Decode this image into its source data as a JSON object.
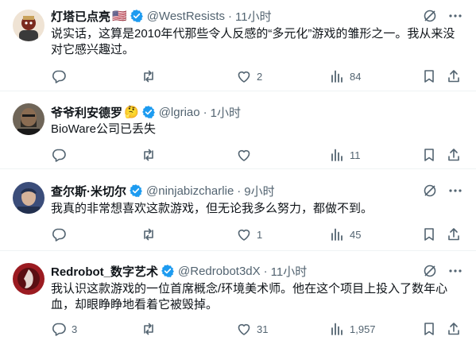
{
  "tweets": [
    {
      "name": "灯塔已点亮",
      "flag": "🇺🇸",
      "handle": "@WestResists",
      "dot": "·",
      "time": "11小时",
      "text": "说实话，这算是2010年代那些令人反感的“多元化”游戏的雏形之一。我从来没对它感兴趣过。",
      "replies": "",
      "reposts": "",
      "likes": "2",
      "views": "84",
      "avatar_colors": [
        "#7a2a1e",
        "#c9a25b",
        "#3a3a3a"
      ]
    },
    {
      "name": "爷爷利安德罗",
      "emoji": "🤔",
      "handle": "@lgriao",
      "dot": "·",
      "time": "1小时",
      "text": "BioWare公司已丢失",
      "replies": "",
      "reposts": "",
      "likes": "",
      "views": "11",
      "avatar_colors": [
        "#2e2b26",
        "#8a6c52",
        "#1a1a1a"
      ]
    },
    {
      "name": "查尔斯·米切尔",
      "handle": "@ninjabizcharlie",
      "dot": "·",
      "time": "9小时",
      "text": "我真的非常想喜欢这款游戏，但无论我多么努力，都做不到。",
      "replies": "",
      "reposts": "",
      "likes": "1",
      "views": "45",
      "avatar_colors": [
        "#3b4d7a",
        "#d5b39a",
        "#22304f"
      ]
    },
    {
      "name": "Redrobot_数字艺术",
      "handle": "@Redrobot3dX",
      "dot": "·",
      "time": "11小时",
      "text": "我认识这款游戏的一位首席概念/环境美术师。他在这个项目上投入了数年心血，却眼睁睁地看着它被毁掉。",
      "replies": "3",
      "reposts": "",
      "likes": "31",
      "views": "1,957",
      "avatar_colors": [
        "#5a0f12",
        "#e4d6cf",
        "#9b1b21"
      ]
    }
  ],
  "colors": {
    "text": "#0f1419",
    "secondary": "#536471",
    "verified": "#1d9bf0",
    "divider": "#eff3f4"
  },
  "icons": [
    "grok-icon",
    "more-icon",
    "reply-icon",
    "repost-icon",
    "like-icon",
    "views-icon",
    "bookmark-icon",
    "share-icon",
    "verified-badge-icon"
  ]
}
